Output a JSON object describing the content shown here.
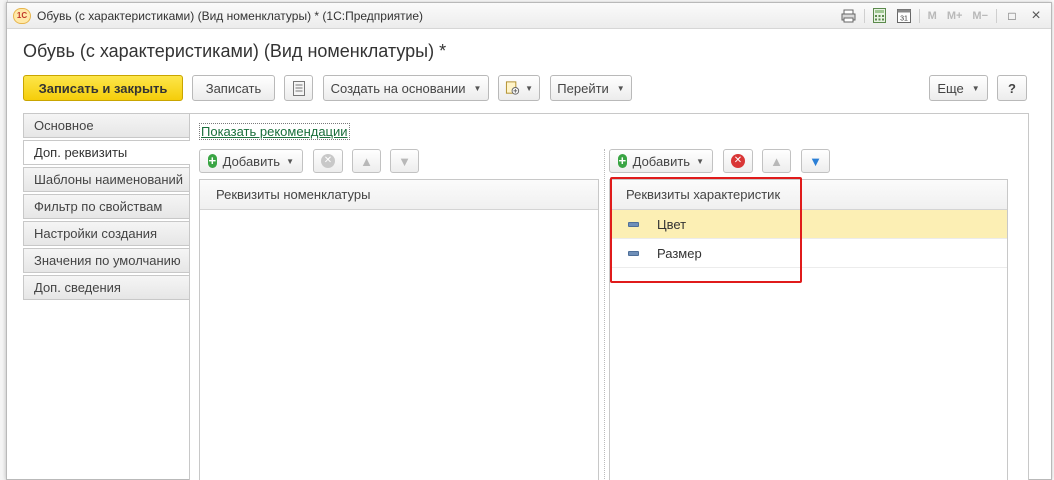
{
  "window": {
    "title": "Обувь (с характеристиками) (Вид номенклатуры) * (1С:Предприятие)",
    "logo_text": "1С",
    "title_icons": [
      "print-icon",
      "calculator-icon",
      "calendar-icon"
    ],
    "calendar_day": "31",
    "memory_buttons": [
      "M",
      "M+",
      "M−"
    ],
    "restore_icon": "□",
    "close_icon": "×"
  },
  "form": {
    "title": "Обувь (с характеристиками) (Вид номенклатуры) *"
  },
  "toolbar": {
    "save_close_label": "Записать и закрыть",
    "save_label": "Записать",
    "create_based_label": "Создать на основании",
    "goto_label": "Перейти",
    "more_label": "Еще",
    "help_label": "?"
  },
  "nav": {
    "items": [
      {
        "label": "Основное"
      },
      {
        "label": "Доп. реквизиты"
      },
      {
        "label": "Шаблоны наименований"
      },
      {
        "label": "Фильтр по свойствам"
      },
      {
        "label": "Настройки создания"
      },
      {
        "label": "Значения по умолчанию"
      },
      {
        "label": "Доп. сведения"
      }
    ],
    "active_index": 1
  },
  "main": {
    "recommendations_link": "Показать рекомендации",
    "left_panel": {
      "add_label": "Добавить",
      "column_header": "Реквизиты номенклатуры",
      "rows": []
    },
    "right_panel": {
      "add_label": "Добавить",
      "column_header": "Реквизиты характеристик",
      "rows": [
        {
          "label": "Цвет",
          "selected": true
        },
        {
          "label": "Размер",
          "selected": false
        }
      ]
    }
  },
  "colors": {
    "primary_button": "#f5cd0a",
    "selected_row": "#fcefb4",
    "highlight_frame": "#e01b1b",
    "link": "#1a6e3b",
    "add_icon": "#3aa544",
    "delete_icon_active": "#d93636"
  }
}
